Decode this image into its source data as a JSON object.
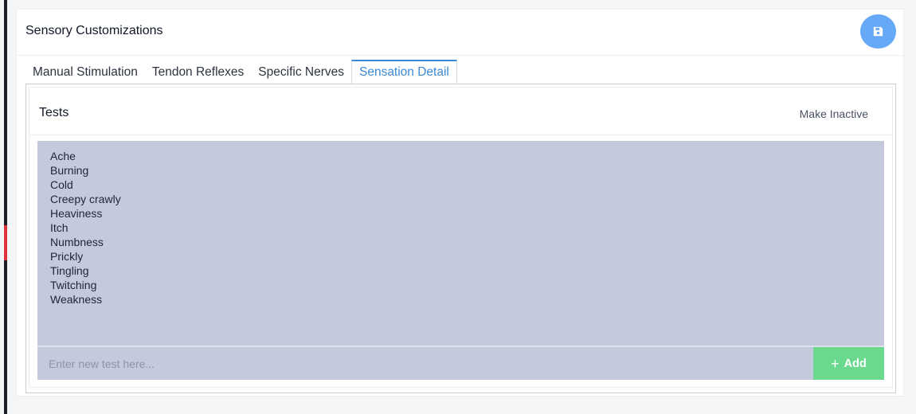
{
  "page": {
    "title": "Sensory Customizations",
    "save_icon": "floppy-disk-icon",
    "accent_color": "#66a9f7"
  },
  "tabs": [
    {
      "label": "Manual Stimulation",
      "active": false
    },
    {
      "label": "Tendon Reflexes",
      "active": false
    },
    {
      "label": "Specific Nerves",
      "active": false
    },
    {
      "label": "Sensation Detail",
      "active": true
    }
  ],
  "tests_panel": {
    "title": "Tests",
    "make_inactive_label": "Make Inactive",
    "items": [
      "Ache",
      "Burning",
      "Cold",
      "Creepy crawly",
      "Heaviness",
      "Itch",
      "Numbness",
      "Prickly",
      "Tingling",
      "Twitching",
      "Weakness"
    ],
    "input": {
      "value": "",
      "placeholder": "Enter new test here..."
    },
    "add_label": "Add",
    "add_icon": "plus-icon",
    "add_color": "#6ad98e"
  }
}
